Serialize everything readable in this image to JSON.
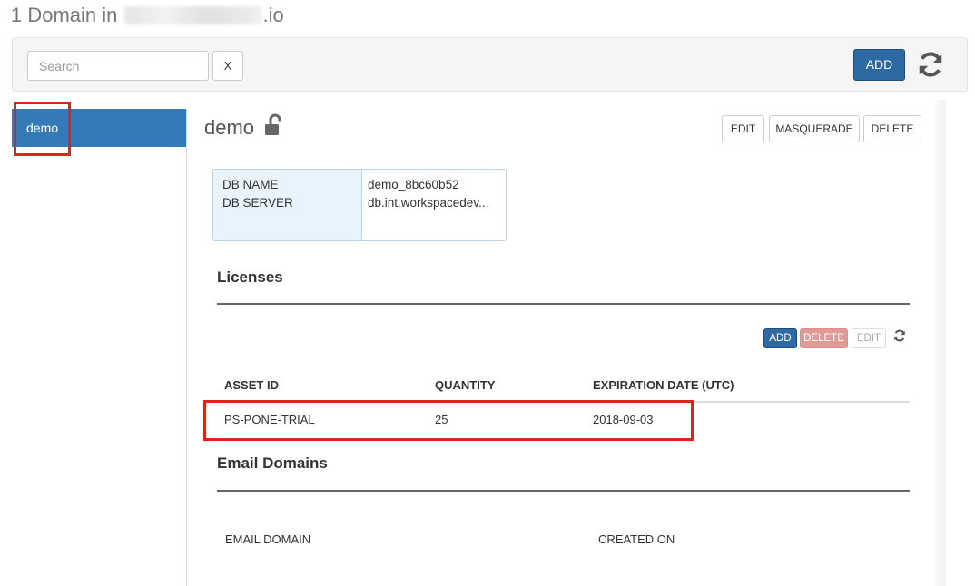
{
  "header": {
    "title_prefix": "1 Domain in",
    "title_suffix": ".io"
  },
  "toolbar": {
    "search_placeholder": "Search",
    "clear_label": "X",
    "add_label": "ADD",
    "refresh_icon": "refresh-icon"
  },
  "sidebar": {
    "items": [
      {
        "label": "demo",
        "selected": true
      }
    ]
  },
  "domain": {
    "name": "demo",
    "lock_icon": "unlocked-lock-icon",
    "actions": {
      "edit": "EDIT",
      "masquerade": "MASQUERADE",
      "delete": "DELETE"
    },
    "db": {
      "labels": [
        "DB NAME",
        "DB SERVER"
      ],
      "values": [
        "demo_8bc60b52",
        "db.int.workspacedev..."
      ]
    }
  },
  "licenses": {
    "heading": "Licenses",
    "actions": {
      "add": "ADD",
      "delete": "DELETE",
      "edit": "EDIT"
    },
    "columns": [
      "ASSET ID",
      "QUANTITY",
      "EXPIRATION DATE (UTC)"
    ],
    "rows": [
      [
        "PS-PONE-TRIAL",
        "25",
        "2018-09-03"
      ]
    ]
  },
  "email_domains": {
    "heading": "Email Domains",
    "columns": [
      "EMAIL DOMAIN",
      "CREATED ON"
    ]
  },
  "colors": {
    "primary": "#2d6aa3",
    "sidebar_selected": "#337ab7",
    "danger_disabled": "#e29a97",
    "highlight": "#d9251a"
  }
}
